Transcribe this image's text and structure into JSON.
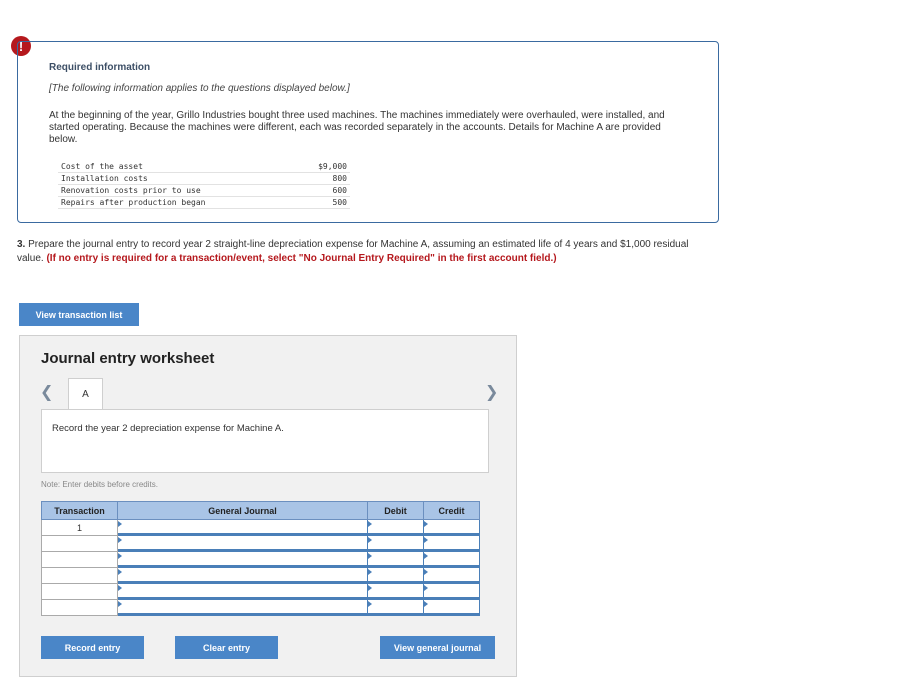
{
  "alert": {
    "symbol": "!"
  },
  "info": {
    "title": "Required information",
    "note": "[The following information applies to the questions displayed below.]",
    "body": "At the beginning of the year, Grillo Industries bought three used machines. The machines immediately were overhauled, were installed, and started operating. Because the machines were different, each was recorded separately in the accounts. Details for Machine A are provided below.",
    "costs": [
      {
        "label": "Cost of the asset",
        "amount": "$9,000"
      },
      {
        "label": "Installation costs",
        "amount": "800"
      },
      {
        "label": "Renovation costs prior to use",
        "amount": "600"
      },
      {
        "label": "Repairs after production began",
        "amount": "500"
      }
    ]
  },
  "question": {
    "number": "3.",
    "text": " Prepare the journal entry to record year 2 straight-line depreciation expense for Machine A, assuming an estimated life of 4 years and $1,000 residual value. ",
    "instruction": "(If no entry is required for a transaction/event, select \"No Journal Entry Required\" in the first account field.)"
  },
  "buttons": {
    "view_transactions": "View transaction list",
    "record_entry": "Record entry",
    "clear_entry": "Clear entry",
    "view_general_journal": "View general journal"
  },
  "worksheet": {
    "title": "Journal entry worksheet",
    "tab_label": "A",
    "task": "Record the year 2 depreciation expense for Machine A.",
    "note": "Note: Enter debits before credits.",
    "columns": {
      "transaction": "Transaction",
      "general_journal": "General Journal",
      "debit": "Debit",
      "credit": "Credit"
    },
    "rows": [
      {
        "transaction": "1"
      },
      {
        "transaction": ""
      },
      {
        "transaction": ""
      },
      {
        "transaction": ""
      },
      {
        "transaction": ""
      },
      {
        "transaction": ""
      }
    ]
  },
  "icons": {
    "prev": "chevron-left-icon",
    "next": "chevron-right-icon",
    "alert": "exclamation-icon"
  }
}
